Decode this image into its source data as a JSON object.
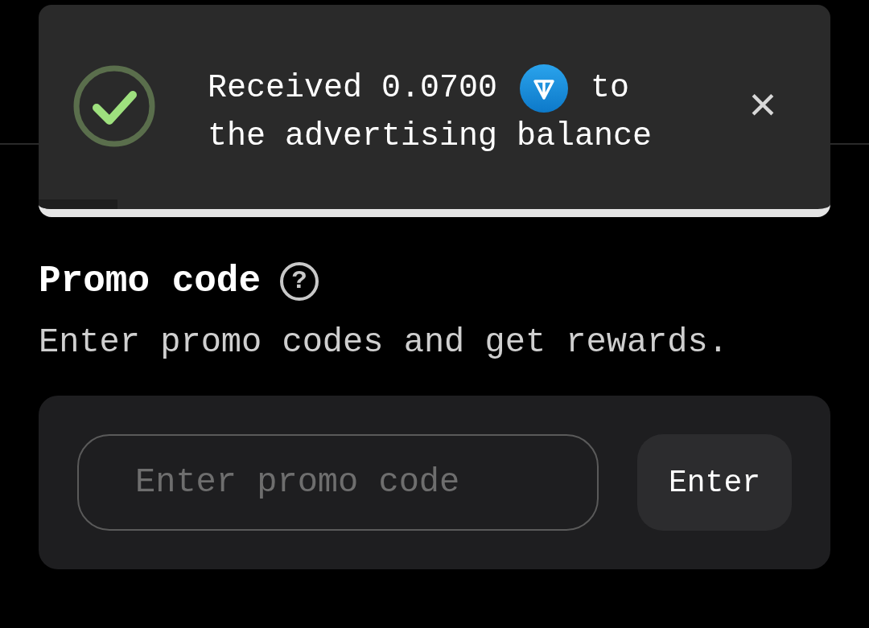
{
  "toast": {
    "text_before": "Received 0.0700",
    "text_after": "to",
    "text_line2": "the advertising balance",
    "close": "×",
    "level": 0.1
  },
  "promo": {
    "title": "Promo code",
    "help": "?",
    "description": "Enter promo codes and get rewards.",
    "placeholder": "Enter promo code",
    "button": "Enter"
  }
}
